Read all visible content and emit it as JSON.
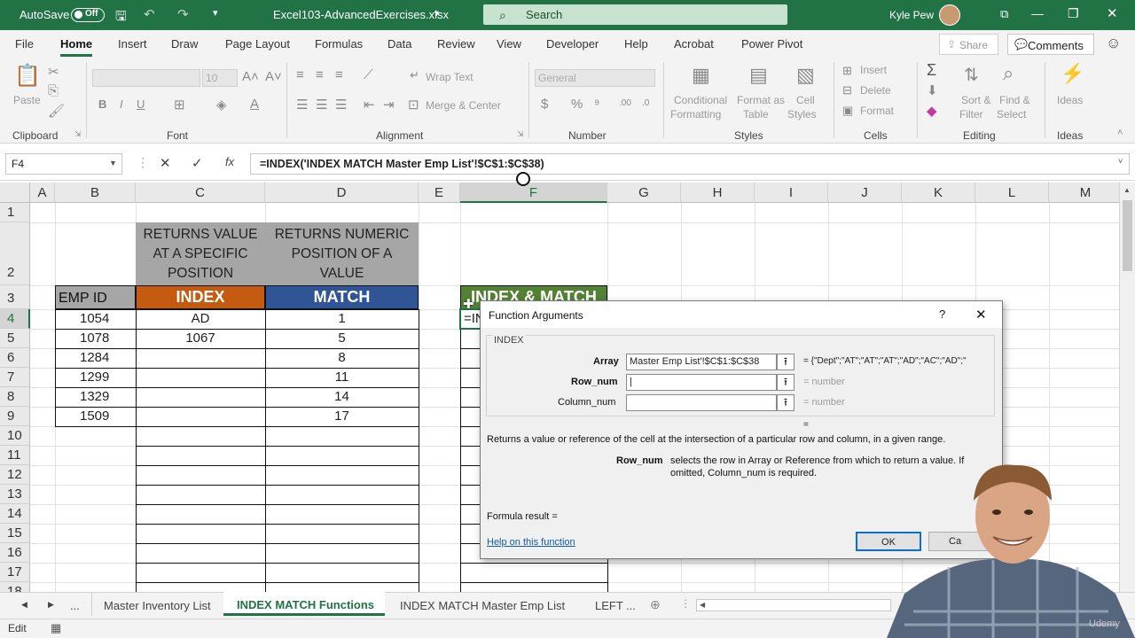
{
  "titlebar": {
    "autosave_label": "AutoSave",
    "autosave_state": "Off",
    "file_name": "Excel103-AdvancedExercises.xlsx",
    "search_placeholder": "Search",
    "user_name": "Kyle Pew",
    "accent_color": "#217346"
  },
  "menu": {
    "items": [
      "File",
      "Home",
      "Insert",
      "Draw",
      "Page Layout",
      "Formulas",
      "Data",
      "Review",
      "View",
      "Developer",
      "Help",
      "Acrobat",
      "Power Pivot"
    ],
    "share_label": "Share",
    "comments_label": "Comments"
  },
  "ribbon": {
    "paste_label": "Paste",
    "font_size": "10",
    "wrap_text": "Wrap Text",
    "merge_center": "Merge & Center",
    "number_format": "General",
    "conditional_formatting": [
      "Conditional",
      "Formatting"
    ],
    "format_as_table": [
      "Format as",
      "Table"
    ],
    "cell_styles": [
      "Cell",
      "Styles"
    ],
    "insert_label": "Insert",
    "delete_label": "Delete",
    "format_label": "Format",
    "sort_filter": [
      "Sort &",
      "Filter"
    ],
    "find_select": [
      "Find &",
      "Select"
    ],
    "ideas_label": "Ideas",
    "groups": {
      "clipboard": "Clipboard",
      "font": "Font",
      "alignment": "Alignment",
      "number": "Number",
      "styles": "Styles",
      "cells": "Cells",
      "editing": "Editing",
      "ideas": "Ideas"
    }
  },
  "formula_bar": {
    "name_box": "F4",
    "formula": "=INDEX('INDEX MATCH Master Emp List'!$C$1:$C$38)"
  },
  "sheet": {
    "columns": [
      "A",
      "B",
      "C",
      "D",
      "E",
      "F",
      "G",
      "H",
      "I",
      "J",
      "K",
      "L",
      "M"
    ],
    "rows": [
      "1",
      "2",
      "3",
      "4",
      "5",
      "6",
      "7",
      "8",
      "9",
      "10",
      "11",
      "12",
      "13",
      "14",
      "15",
      "16",
      "17",
      "18"
    ],
    "c2": [
      "RETURNS VALUE",
      "AT A SPECIFIC",
      "POSITION"
    ],
    "d2": [
      "RETURNS NUMERIC",
      "POSITION OF A",
      "VALUE"
    ],
    "b3": "EMP ID",
    "c3": "INDEX",
    "d3": "MATCH",
    "f3": "INDEX & MATCH",
    "f4": "=IN",
    "emp_ids": [
      "1054",
      "1078",
      "1284",
      "1299",
      "1329",
      "1509"
    ],
    "index_values": [
      "AD",
      "1067"
    ],
    "match_values": [
      "1",
      "5",
      "8",
      "11",
      "14",
      "17"
    ],
    "index_color": "#c55a11",
    "match_color": "#2f5597",
    "header_gray": "#a6a6a6",
    "index_match_green": "#548235"
  },
  "dialog": {
    "title": "Function Arguments",
    "help_char": "?",
    "close_char": "✕",
    "function_name": "INDEX",
    "args": [
      {
        "label": "Array",
        "value": "Master Emp List'!$C$1:$C$38",
        "result": "= {\"Dept\";\"AT\";\"AT\";\"AT\";\"AD\";\"AC\";\"AD\";\""
      },
      {
        "label": "Row_num",
        "value": "|",
        "result": "= number"
      },
      {
        "label": "Column_num",
        "value": "",
        "result": "= number"
      }
    ],
    "equals": "=",
    "description": "Returns a value or reference of the cell at the intersection of a particular row and column, in a given range.",
    "arg_help_name": "Row_num",
    "arg_help_text": [
      "selects the row in Array or Reference from which to return a value. If",
      "omitted, Column_num is required."
    ],
    "formula_result": "Formula result =",
    "help_link": "Help on this function",
    "ok_label": "OK",
    "cancel_label": "Ca"
  },
  "sheet_tabs": {
    "ellipsis": "...",
    "tabs": [
      "Master Inventory List",
      "INDEX MATCH Functions",
      "INDEX MATCH Master Emp List",
      "LEFT"
    ],
    "more": "..."
  },
  "status": {
    "mode": "Edit",
    "watermark": "Udemy"
  }
}
